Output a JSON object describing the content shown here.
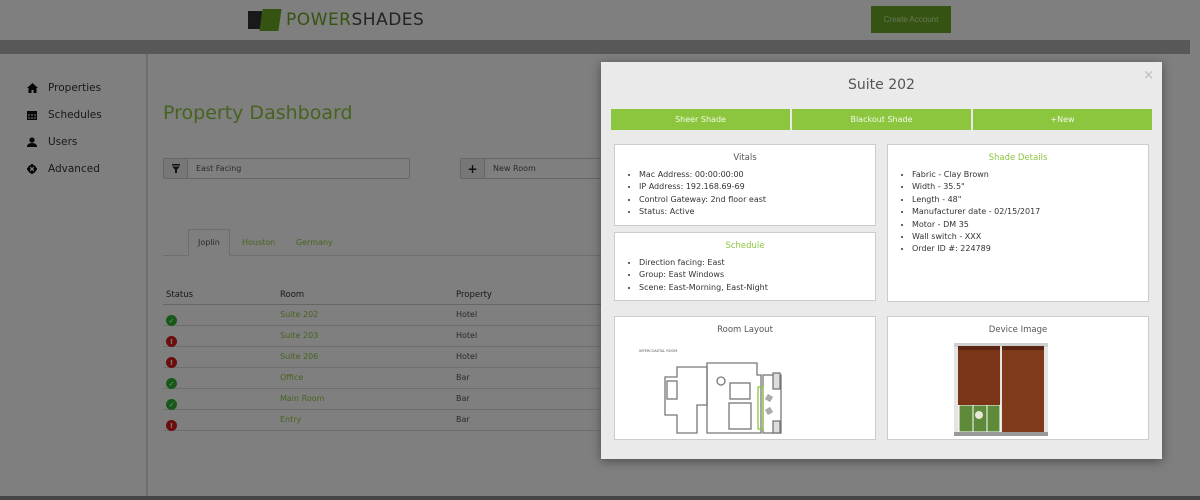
{
  "header": {
    "logo_text_part1": "POWER",
    "logo_text_part2": "SHADES",
    "create_account_label": "Create Account"
  },
  "sidebar": {
    "items": [
      {
        "label": "Properties",
        "icon": "home-icon"
      },
      {
        "label": "Schedules",
        "icon": "calendar-icon"
      },
      {
        "label": "Users",
        "icon": "user-icon"
      },
      {
        "label": "Advanced",
        "icon": "gear-icon"
      }
    ]
  },
  "main": {
    "title": "Property Dashboard",
    "filter": {
      "value": "East Facing",
      "icon": "filter-icon"
    },
    "new_room": {
      "placeholder": "New Room",
      "icon": "plus-icon"
    },
    "tabs": [
      {
        "label": "Joplin",
        "active": true
      },
      {
        "label": "Houston",
        "active": false
      },
      {
        "label": "Germany",
        "active": false
      }
    ],
    "table": {
      "headers": [
        "Status",
        "Room",
        "Property"
      ],
      "rows": [
        {
          "status": "ok",
          "room": "Suite 202",
          "property": "Hotel"
        },
        {
          "status": "error",
          "room": "Suite 203",
          "property": "Hotel"
        },
        {
          "status": "error",
          "room": "Suite 206",
          "property": "Hotel"
        },
        {
          "status": "ok",
          "room": "Office",
          "property": "Bar"
        },
        {
          "status": "ok",
          "room": "Main Room",
          "property": "Bar"
        },
        {
          "status": "error",
          "room": "Entry",
          "property": "Bar"
        }
      ]
    }
  },
  "modal": {
    "title": "Suite 202",
    "close_glyph": "×",
    "shade_tabs": [
      "Sheer Shade",
      "Blackout Shade",
      "+New"
    ],
    "vitals": {
      "title": "Vitals",
      "items": [
        "Mac Address: 00:00:00:00",
        "IP Address: 192.168.69-69",
        "Control Gateway: 2nd floor east",
        "Status: Active"
      ]
    },
    "schedule": {
      "title": "Schedule",
      "items": [
        "Direction facing: East",
        "Group: East Windows",
        "Scene: East-Morning, East-Night"
      ]
    },
    "shade_details": {
      "title": "Shade Details",
      "items": [
        "Fabric - Clay Brown",
        "Width - 35.5\"",
        "Length - 48\"",
        "Manufacturer date - 02/15/2017",
        "Motor - DM 35",
        "Wall switch - XXX",
        "Order ID #: 224789"
      ]
    },
    "room_layout": {
      "title": "Room Layout",
      "plan_label": "INTERCOASTAL ROOM"
    },
    "device_image": {
      "title": "Device Image"
    }
  },
  "colors": {
    "brand_green": "#8cc63f",
    "dark_green": "#6aa823",
    "status_ok": "#2db233",
    "status_error": "#d51c1c"
  }
}
